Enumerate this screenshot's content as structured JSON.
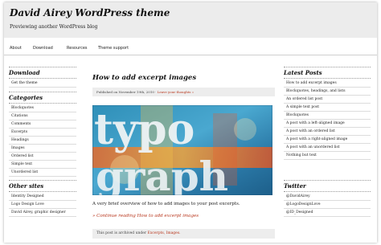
{
  "header": {
    "title": "David Airey WordPress theme",
    "tagline": "Previewing another WordPress blog"
  },
  "nav": [
    "About",
    "Download",
    "Resources",
    "Theme support"
  ],
  "left_sidebar": {
    "sections": [
      {
        "heading": "Download",
        "items": [
          "Get the theme"
        ]
      },
      {
        "heading": "Categories",
        "items": [
          "Blockquotes",
          "Citations",
          "Comments",
          "Excerpts",
          "Headings",
          "Images",
          "Ordered list",
          "Simple text",
          "Unordered list"
        ]
      },
      {
        "heading": "Other sites",
        "items": [
          "Identity Designed",
          "Logo Design Love",
          "David Airey, graphic designer"
        ]
      }
    ]
  },
  "post": {
    "title": "How to add excerpt images",
    "meta_prefix": "Published on November 19th, 2010 ·",
    "meta_link": "Leave your thoughts »",
    "excerpt": "A very brief overview of how to add images to your post excerpts.",
    "read_more": "» Continue reading How to add excerpt images",
    "archived_prefix": "This post is archived under",
    "archived_links": "Excerpts, Images."
  },
  "right_sidebar": {
    "sections": [
      {
        "heading": "Latest Posts",
        "items": [
          "How to add excerpt images",
          "Blockquotes, headings, and lists",
          "An ordered list post",
          "A simple text post",
          "Blockquotes",
          "A post with a left-aligned image",
          "A post with an ordered list",
          "A post with a right-aligned image",
          "A post with an unordered list",
          "Nothing but text"
        ]
      },
      {
        "heading": "Twitter",
        "items": [
          "@DavidAirey",
          "@LogoDesignLove",
          "@ID_Designed"
        ]
      }
    ]
  },
  "colors": {
    "accent_link": "#b8351b",
    "header_bg": "#ececec",
    "meta_bg": "#ededed"
  }
}
